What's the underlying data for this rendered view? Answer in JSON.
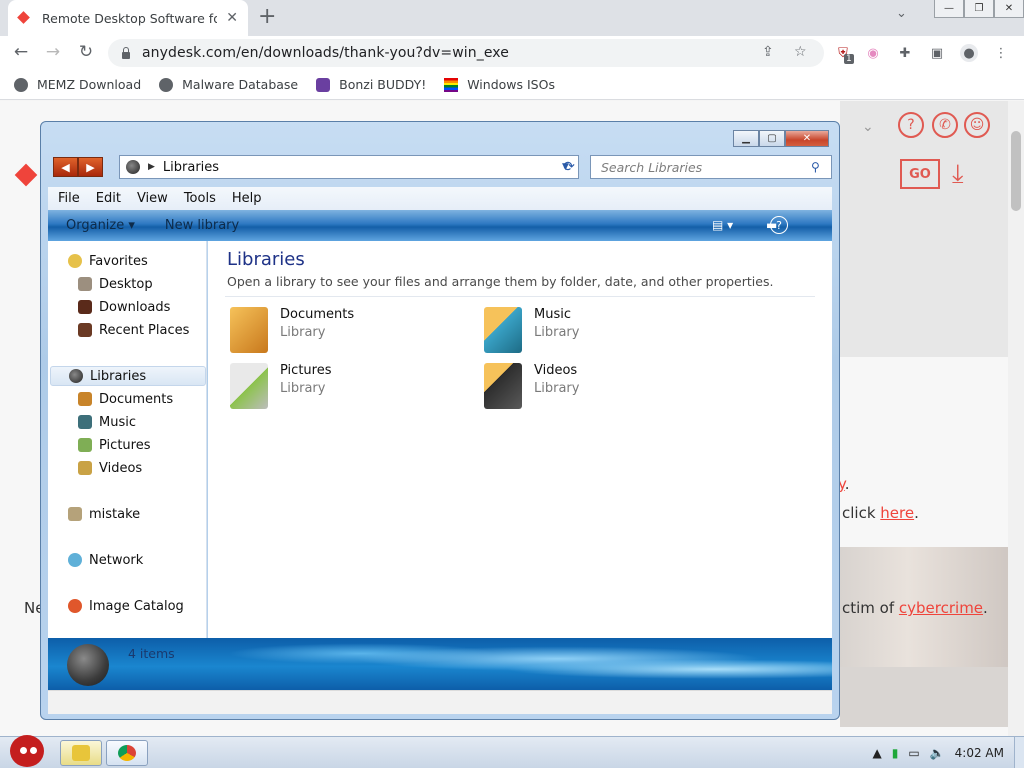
{
  "browser": {
    "tab_title": "Remote Desktop Software for",
    "tab_close": "✕",
    "new_tab": "+",
    "url": "anydesk.com/en/downloads/thank-you?dv=win_exe",
    "bookmarks": [
      {
        "label": "MEMZ Download",
        "icon": "globe-icon"
      },
      {
        "label": "Malware Database",
        "icon": "globe-icon"
      },
      {
        "label": "Bonzi BUDDY!",
        "icon": "bonzi-icon"
      },
      {
        "label": "Windows ISOs",
        "icon": "windows-flag-icon"
      }
    ],
    "extension_badge": "1"
  },
  "webpage": {
    "text_click": "click ",
    "link_here": "here",
    "link_y": "y",
    "text_victim": "ctim of ",
    "link_cybercrime": "cybercrime",
    "text_left": "Ne",
    "go_label": "GO",
    "accent": "#ef443b"
  },
  "explorer": {
    "address": "Libraries",
    "search_placeholder": "Search Libraries",
    "menu": [
      "File",
      "Edit",
      "View",
      "Tools",
      "Help"
    ],
    "commands": {
      "organize": "Organize ▾",
      "new_library": "New library"
    },
    "nav": {
      "favorites": "Favorites",
      "fav_items": [
        "Desktop",
        "Downloads",
        "Recent Places"
      ],
      "libraries": "Libraries",
      "lib_items": [
        "Documents",
        "Music",
        "Pictures",
        "Videos"
      ],
      "user": "mistake",
      "network": "Network",
      "image_catalog": "Image Catalog"
    },
    "heading": "Libraries",
    "subheading": "Open a library to see your files and arrange them by folder, date, and other properties.",
    "libraries": [
      {
        "name": "Documents",
        "type": "Library"
      },
      {
        "name": "Music",
        "type": "Library"
      },
      {
        "name": "Pictures",
        "type": "Library"
      },
      {
        "name": "Videos",
        "type": "Library"
      }
    ],
    "item_count": "4 items"
  },
  "taskbar": {
    "clock": "4:02 AM"
  }
}
